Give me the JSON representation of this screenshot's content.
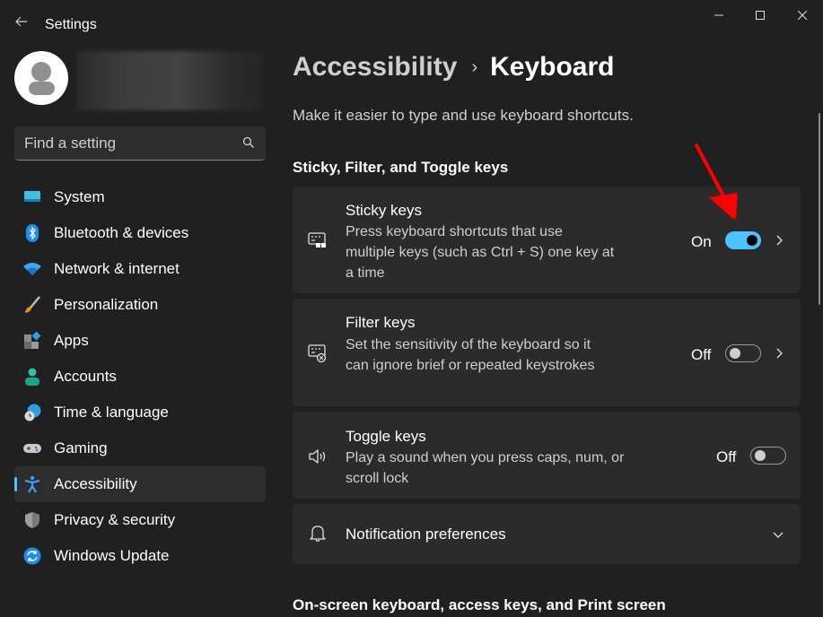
{
  "window": {
    "title": "Settings",
    "controls": {
      "minimize": "minimize",
      "maximize": "maximize",
      "close": "close"
    }
  },
  "sidebar": {
    "search_placeholder": "Find a setting",
    "items": [
      {
        "label": "System",
        "icon": "system-icon",
        "active": false
      },
      {
        "label": "Bluetooth & devices",
        "icon": "bluetooth-icon",
        "active": false
      },
      {
        "label": "Network & internet",
        "icon": "wifi-icon",
        "active": false
      },
      {
        "label": "Personalization",
        "icon": "brush-icon",
        "active": false
      },
      {
        "label": "Apps",
        "icon": "apps-icon",
        "active": false
      },
      {
        "label": "Accounts",
        "icon": "accounts-icon",
        "active": false
      },
      {
        "label": "Time & language",
        "icon": "time-language-icon",
        "active": false
      },
      {
        "label": "Gaming",
        "icon": "gamepad-icon",
        "active": false
      },
      {
        "label": "Accessibility",
        "icon": "accessibility-icon",
        "active": true
      },
      {
        "label": "Privacy & security",
        "icon": "shield-icon",
        "active": false
      },
      {
        "label": "Windows Update",
        "icon": "update-icon",
        "active": false
      }
    ]
  },
  "main": {
    "breadcrumb": {
      "parent": "Accessibility",
      "separator": "›",
      "current": "Keyboard"
    },
    "description": "Make it easier to type and use keyboard shortcuts.",
    "sections": [
      {
        "title": "Sticky, Filter, and Toggle keys"
      },
      {
        "title": "On-screen keyboard, access keys, and Print screen"
      }
    ],
    "cards": [
      {
        "title": "Sticky keys",
        "description": "Press keyboard shortcuts that use multiple keys (such as Ctrl + S) one key at a time",
        "state_label": "On",
        "toggle_on": true,
        "has_chevron": true
      },
      {
        "title": "Filter keys",
        "description": "Set the sensitivity of the keyboard so it can ignore brief or repeated keystrokes",
        "state_label": "Off",
        "toggle_on": false,
        "has_chevron": true
      },
      {
        "title": "Toggle keys",
        "description": "Play a sound when you press caps, num, or scroll lock",
        "state_label": "Off",
        "toggle_on": false,
        "has_chevron": false
      },
      {
        "title": "Notification preferences",
        "expandable": true
      }
    ]
  },
  "colors": {
    "accent": "#4cc2ff",
    "background": "#202020",
    "card": "#2b2b2b",
    "annotation_arrow": "#ff0000"
  }
}
